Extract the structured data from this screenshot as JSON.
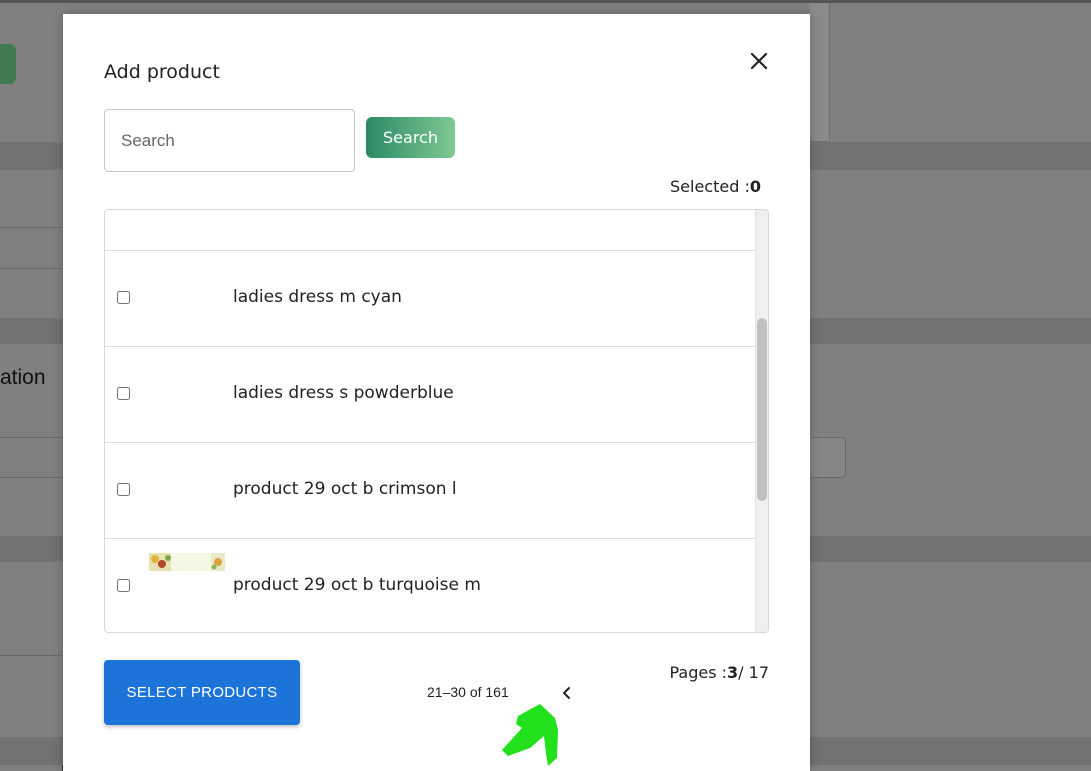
{
  "background": {
    "heading_fragment": "ation"
  },
  "modal": {
    "title": "Add product",
    "close_icon": "close-icon",
    "search": {
      "placeholder": "Search",
      "value": "",
      "button_label": "Search"
    },
    "selected": {
      "label": "Selected :",
      "count": "0"
    },
    "list": {
      "items": [
        {
          "name": "",
          "checked": false,
          "has_thumbnail": false
        },
        {
          "name": "ladies dress m cyan",
          "checked": false,
          "has_thumbnail": false
        },
        {
          "name": "ladies dress s powderblue",
          "checked": false,
          "has_thumbnail": false
        },
        {
          "name": "product 29 oct b crimson l",
          "checked": false,
          "has_thumbnail": false
        },
        {
          "name": "product 29 oct b turquoise m",
          "checked": false,
          "has_thumbnail": true
        }
      ]
    },
    "footer": {
      "select_button_label": "SELECT PRODUCTS",
      "range_text": "21–30 of 161",
      "prev_icon": "chevron-left-icon",
      "pages_label": "Pages :",
      "current_page": "3",
      "total_pages": "/ 17"
    }
  },
  "colors": {
    "search_button_gradient_start": "#2b8a64",
    "search_button_gradient_end": "#80c994",
    "select_button": "#1c74d9",
    "annotation_arrow": "#22e01b",
    "overlay": "#808080"
  }
}
